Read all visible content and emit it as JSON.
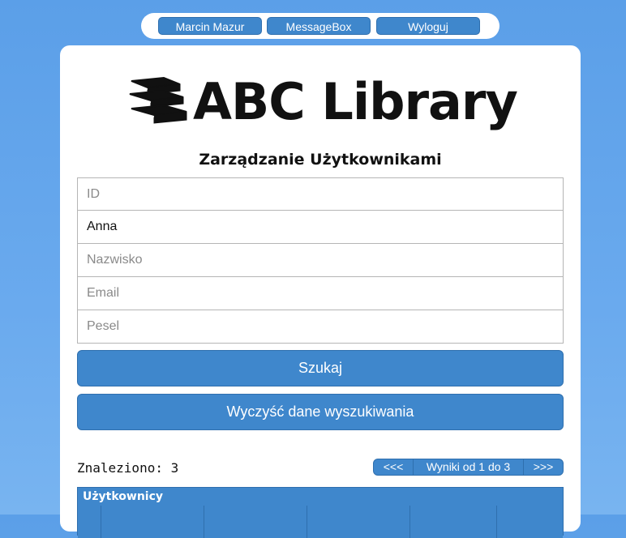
{
  "nav": {
    "user_label": "Marcin Mazur",
    "messagebox_label": "MessageBox",
    "logout_label": "Wyloguj"
  },
  "logo": {
    "text": "ABC Library"
  },
  "page": {
    "title": "Zarządzanie Użytkownikami"
  },
  "form": {
    "id": {
      "value": "",
      "placeholder": "ID"
    },
    "imie": {
      "value": "Anna",
      "placeholder": ""
    },
    "nazwisko": {
      "value": "",
      "placeholder": "Nazwisko"
    },
    "email": {
      "value": "",
      "placeholder": "Email"
    },
    "pesel": {
      "value": "",
      "placeholder": "Pesel"
    }
  },
  "buttons": {
    "search_label": "Szukaj",
    "clear_label": "Wyczyść dane wyszukiwania"
  },
  "results": {
    "found_text": "Znaleziono: 3",
    "prev_label": "<<<",
    "range_text": "Wyniki od 1 do 3",
    "next_label": ">>>"
  },
  "table": {
    "header": "Użytkownicy"
  },
  "colors": {
    "accent": "#3f87cc",
    "background": "#5b9fe8"
  }
}
